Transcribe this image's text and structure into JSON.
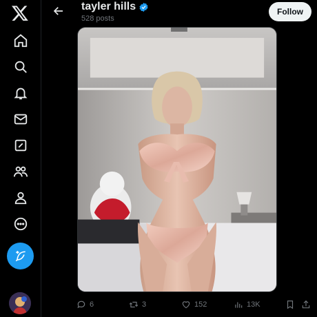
{
  "profile": {
    "name": "tayler hills",
    "posts_count": "528 posts",
    "follow_label": "Follow"
  },
  "sidebar": {
    "items": [
      {
        "icon": "x-logo-icon"
      },
      {
        "icon": "home-icon"
      },
      {
        "icon": "search-icon"
      },
      {
        "icon": "notifications-icon"
      },
      {
        "icon": "messages-icon"
      },
      {
        "icon": "grok-icon"
      },
      {
        "icon": "communities-icon"
      },
      {
        "icon": "profile-icon"
      },
      {
        "icon": "more-icon"
      }
    ],
    "compose_icon": "feather-plus-icon"
  },
  "post": {
    "media_description_icon": "photo",
    "stats": {
      "replies": "6",
      "reposts": "3",
      "likes": "152",
      "views": "13K"
    }
  },
  "colors": {
    "accent": "#1d9bf0",
    "background": "#000000",
    "text_primary": "#e7e9ea",
    "text_secondary": "#71767b"
  }
}
